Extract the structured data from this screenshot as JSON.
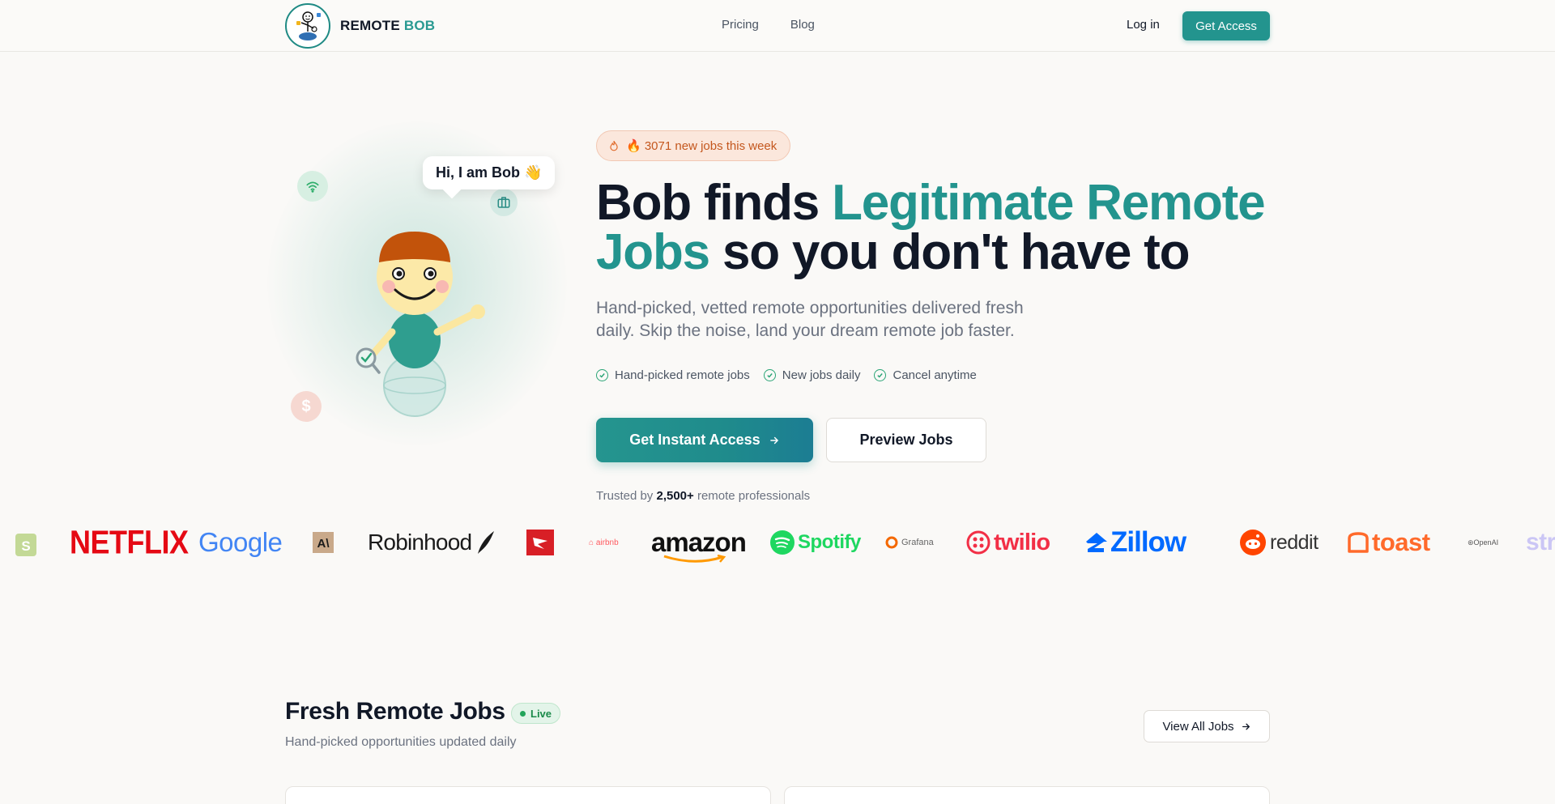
{
  "header": {
    "brand_main": "REMOTE ",
    "brand_accent": "BOB",
    "nav": [
      "Pricing",
      "Blog"
    ],
    "login": "Log in",
    "cta": "Get Access"
  },
  "hero": {
    "bubble": "Hi, I am Bob 👋",
    "badge": "🔥 3071 new jobs this week",
    "headline_a": "Bob finds ",
    "headline_b": "Legitimate Remote",
    "headline_c": "Jobs",
    "headline_d": " so you don't have to",
    "subtext": "Hand-picked, vetted remote opportunities delivered fresh daily. Skip the noise, land your dream remote job faster.",
    "features": [
      "Hand-picked remote jobs",
      "New jobs daily",
      "Cancel anytime"
    ],
    "primary_cta": "Get Instant Access",
    "secondary_cta": "Preview Jobs",
    "trusted_prefix": "Trusted by ",
    "trusted_count": "2,500+",
    "trusted_suffix": " remote professionals"
  },
  "company_logos": [
    "Netflix",
    "Google",
    "Anthropic",
    "Robinhood",
    "Airbnb",
    "amazon",
    "Spotify",
    "Grafana",
    "twilio",
    "Zillow",
    "reddit",
    "toast",
    "OpenAI",
    "stripe"
  ],
  "company_logo_text": {
    "netflix": "NETFLIX",
    "google": "Google",
    "robinhood": "Robinhood",
    "airbnb": "airbnb",
    "amazon": "amazon",
    "spotify": "Spotify",
    "grafana": "Grafana",
    "twilio": "twilio",
    "zillow": "Zillow",
    "reddit": "reddit",
    "toast": "toast",
    "openai": "OpenAI",
    "stripe": "stri"
  },
  "jobs": {
    "title": "Fresh Remote Jobs",
    "live": "Live",
    "subtitle": "Hand-picked opportunities updated daily",
    "view_all": "View All Jobs"
  },
  "colors": {
    "brand_teal": "#23948e",
    "heading": "#111827",
    "muted": "#6b7280",
    "badge_orange": "#c4571e"
  },
  "icons": [
    "flame-icon",
    "wifi-icon",
    "briefcase-icon",
    "dollar-icon",
    "magnifier-icon",
    "check-circle-icon",
    "arrow-right-icon"
  ]
}
